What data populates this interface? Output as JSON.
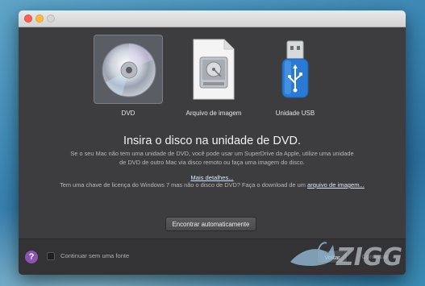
{
  "window": {
    "title": ""
  },
  "sources": [
    {
      "label": "DVD",
      "icon": "dvd-disc-icon",
      "selected": true
    },
    {
      "label": "Arquivo de imagem",
      "icon": "disk-image-file-icon",
      "selected": false
    },
    {
      "label": "Unidade USB",
      "icon": "usb-drive-icon",
      "selected": false
    }
  ],
  "main": {
    "title": "Insira o disco na unidade de DVD.",
    "description": "Se o seu Mac não tem uma unidade de DVD, você pode usar um SuperDrive da Apple, utilize uma unidade de DVD de outro Mac via disco remoto ou faça uma imagem do disco.",
    "details_link": "Mais detalhes...",
    "license_text": "Tem uma chave de licença do Windows 7 mas não o disco de DVD? Faça o download de um",
    "license_link": "arquivo de imagem...",
    "auto_button": "Encontrar automaticamente"
  },
  "footer": {
    "help_label": "?",
    "checkbox_label": "Continuar sem uma fonte",
    "back_button": "Voltar",
    "continue_button": "Continuar"
  },
  "watermark": {
    "text": "ZIGG"
  },
  "colors": {
    "help_button": "#8a54b0",
    "window_bg": "#3d3d3f",
    "usb_blue": "#2a7ad4"
  }
}
